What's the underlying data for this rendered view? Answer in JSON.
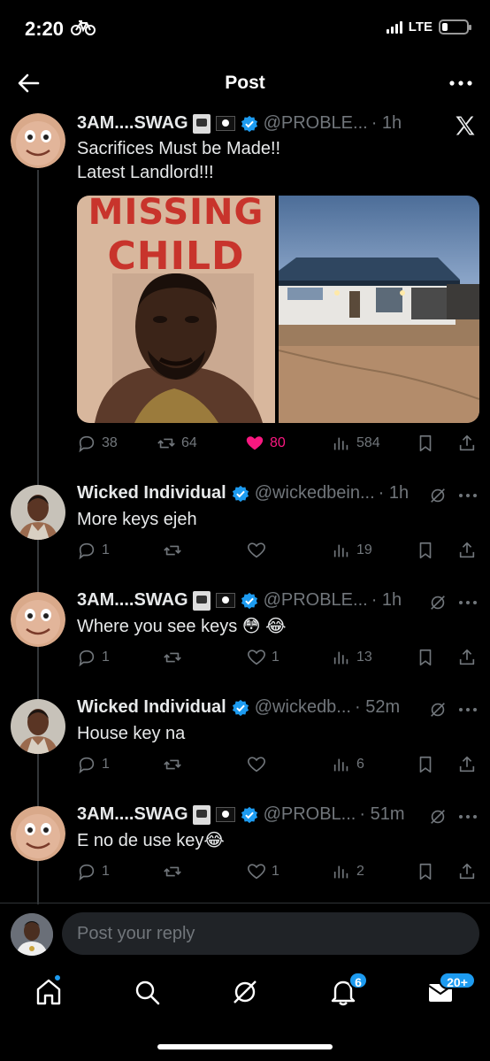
{
  "status_bar": {
    "time": "2:20",
    "network": "LTE",
    "icons": [
      "bicycle-icon",
      "signal-icon",
      "battery-icon"
    ]
  },
  "header": {
    "title": "Post"
  },
  "main_post": {
    "author": "3AM....SWAG",
    "handle": "@PROBLE...",
    "time": "· 1h",
    "text_line1": "Sacrifices Must be Made!!",
    "text_line2": "Latest Landlord!!!",
    "image_left_text1": "MISSING",
    "image_left_text2": "CHILD",
    "replies": "38",
    "reposts": "64",
    "likes": "80",
    "views": "584"
  },
  "replies": [
    {
      "author": "Wicked Individual",
      "handle": "@wickedbein...",
      "time": "· 1h",
      "text": "More keys ejeh",
      "replies": "1",
      "reposts": "",
      "likes": "",
      "views": "19"
    },
    {
      "author": "3AM....SWAG",
      "handle": "@PROBLE...",
      "time": "· 1h",
      "text": "Where you see keys 😳 😂",
      "replies": "1",
      "reposts": "",
      "likes": "1",
      "views": "13"
    },
    {
      "author": "Wicked Individual",
      "handle": "@wickedb...",
      "time": "· 52m",
      "text": "House key na",
      "replies": "1",
      "reposts": "",
      "likes": "",
      "views": "6"
    },
    {
      "author": "3AM....SWAG",
      "handle": "@PROBL...",
      "time": "· 51m",
      "text": "E no de use key😂",
      "replies": "1",
      "reposts": "",
      "likes": "1",
      "views": "2"
    }
  ],
  "reply_bar": {
    "placeholder": "Post your reply"
  },
  "tabbar": {
    "notifications_badge": "6",
    "messages_badge": "20+"
  },
  "colors": {
    "accent": "#1d9bf0",
    "like": "#f91880",
    "muted": "#71767b",
    "background": "#000000"
  }
}
